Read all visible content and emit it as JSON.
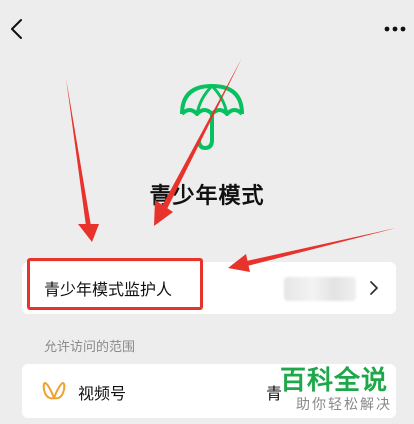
{
  "page": {
    "title": "青少年模式"
  },
  "guardian": {
    "label": "青少年模式监护人"
  },
  "section": {
    "label": "允许访问的范围"
  },
  "video": {
    "label": "视频号",
    "state": "青"
  },
  "watermark": {
    "main": "百科全说",
    "sub": "助你轻松解决"
  },
  "icons": {
    "back": "chevron-left-icon",
    "more": "more-dots-icon",
    "hero": "umbrella-icon",
    "row_arrow": "chevron-right-icon",
    "video": "channels-butterfly-icon"
  },
  "colors": {
    "background": "#ededed",
    "card": "#ffffff",
    "brand_green": "#07c160",
    "arrow_red": "#e8322c",
    "video_icon": "#f0a030",
    "watermark_green": "#1fa84a",
    "muted_text": "#8a8a8a"
  }
}
